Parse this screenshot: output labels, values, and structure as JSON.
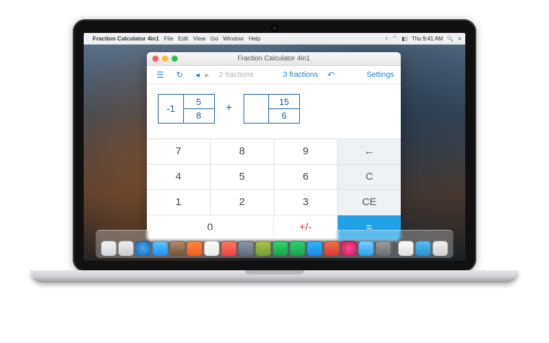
{
  "menubar": {
    "app_name": "Fraction Calculator 4in1",
    "menus": [
      "File",
      "Edit",
      "View",
      "Go",
      "Window",
      "Help"
    ],
    "time": "Thu 9:41 AM"
  },
  "window": {
    "title": "Fraction Calculator 4in1"
  },
  "toolbar": {
    "two_fractions": "2 fractions",
    "three_fractions": "3 fractions",
    "settings": "Settings"
  },
  "expression": {
    "term1": {
      "whole": "-1",
      "numerator": "5",
      "denominator": "8"
    },
    "operator": "+",
    "term2": {
      "whole": "",
      "numerator": "15",
      "denominator": "6"
    }
  },
  "keys": {
    "k7": "7",
    "k8": "8",
    "k9": "9",
    "back": "←",
    "k4": "4",
    "k5": "5",
    "k6": "6",
    "clear": "C",
    "k1": "1",
    "k2": "2",
    "k3": "3",
    "ce": "CE",
    "k0": "0",
    "sign": "+/-",
    "eq": "="
  },
  "colors": {
    "accent": "#1e7fd6",
    "fraction_border": "#1859a9",
    "equals_bg": "#1ea1e6"
  },
  "dock": {
    "count": 22
  }
}
